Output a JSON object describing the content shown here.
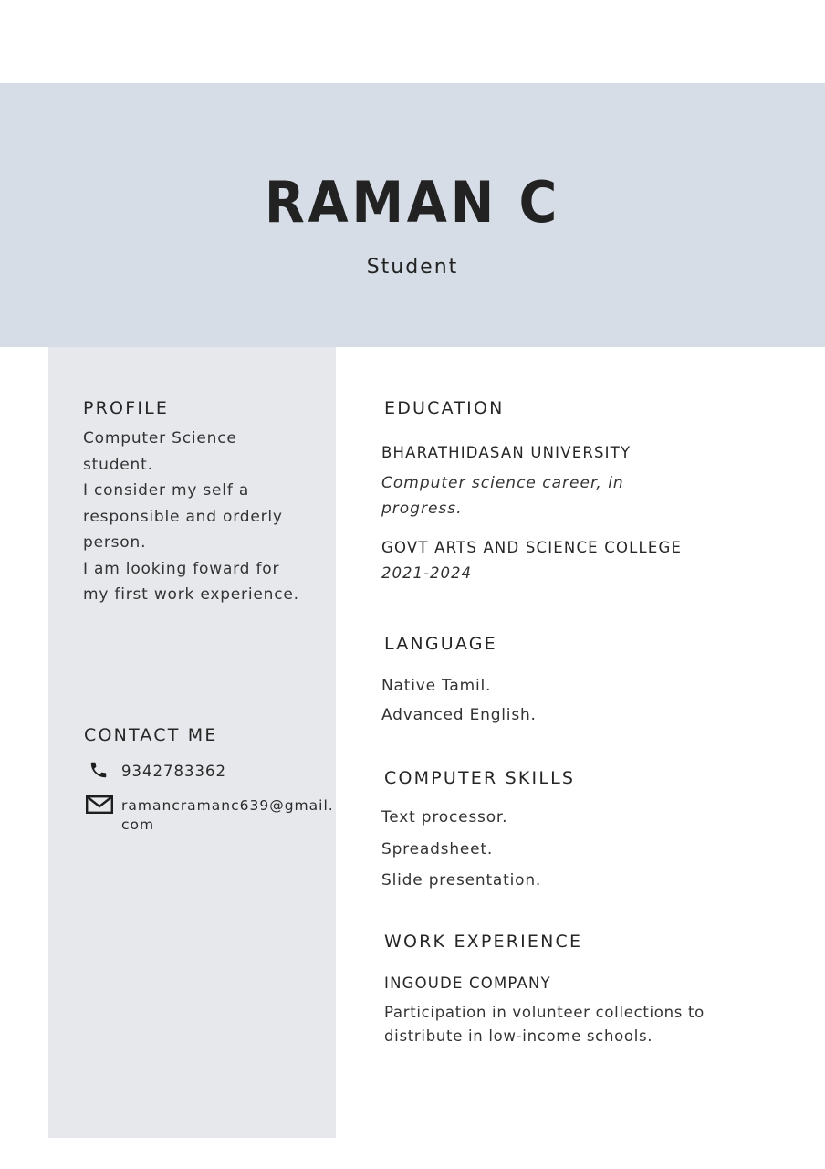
{
  "header": {
    "name": "RAMAN C",
    "role": "Student"
  },
  "profile": {
    "heading": "PROFILE",
    "lines": [
      "Computer Science",
      "student.",
      "I consider my self a",
      "responsible and orderly",
      "person.",
      "I am looking foward for",
      "my first work experience."
    ]
  },
  "contact": {
    "heading": "CONTACT ME",
    "phone": "9342783362",
    "email_line1": "ramancramanc639@gmail.",
    "email_line2": "com"
  },
  "education": {
    "heading": "EDUCATION",
    "entries": [
      {
        "school": "BHARATHIDASAN UNIVERSITY",
        "detail_line1": "Computer science career, in",
        "detail_line2": "progress."
      },
      {
        "school": "GOVT ARTS AND SCIENCE COLLEGE",
        "detail_line1": "2021-2024"
      }
    ]
  },
  "language": {
    "heading": "LANGUAGE",
    "items": [
      "Native Tamil.",
      "Advanced English."
    ]
  },
  "computer_skills": {
    "heading": "COMPUTER SKILLS",
    "items": [
      "Text processor.",
      "Spreadsheet.",
      "Slide presentation."
    ]
  },
  "work": {
    "heading": "WORK EXPERIENCE",
    "company": "INGOUDE COMPANY",
    "desc_line1": "Participation in volunteer collections to",
    "desc_line2": "distribute in low-income schools."
  }
}
